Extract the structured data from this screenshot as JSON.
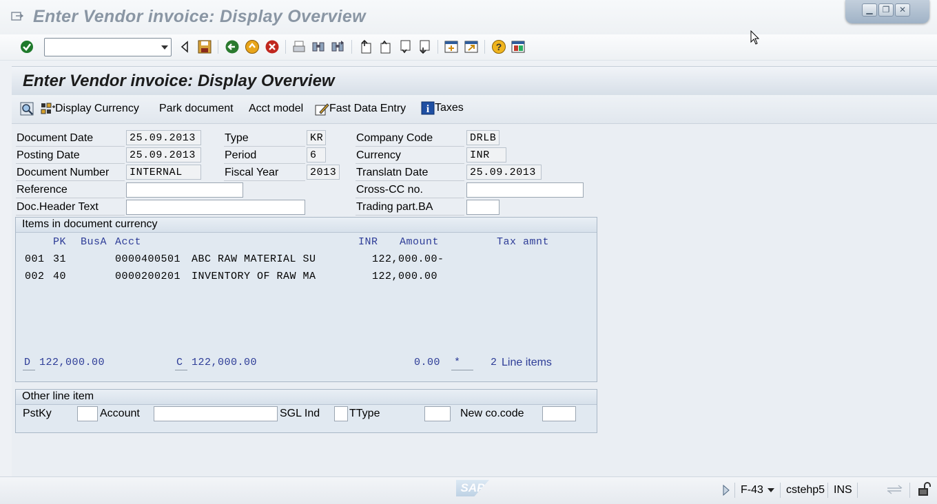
{
  "window": {
    "title": "Enter Vendor invoice: Display Overview"
  },
  "toolbar": {
    "command_value": "",
    "icons": [
      "enter-checkmark-icon",
      "back-arrow-icon",
      "save-icon",
      "back-green-icon",
      "exit-yellow-icon",
      "cancel-red-icon",
      "print-icon",
      "find-icon",
      "find-next-icon",
      "first-page-icon",
      "previous-page-icon",
      "next-page-icon",
      "last-page-icon",
      "new-session-icon",
      "shortcut-icon",
      "help-icon",
      "layout-menu-icon"
    ]
  },
  "screen": {
    "title": "Enter Vendor invoice: Display Overview"
  },
  "app_toolbar": {
    "display_currency": "Display Currency",
    "park_document": "Park document",
    "acct_model": "Acct model",
    "fast_data_entry": "Fast Data Entry",
    "taxes": "Taxes"
  },
  "header": {
    "document_date": {
      "label": "Document Date",
      "value": "25.09.2013"
    },
    "posting_date": {
      "label": "Posting Date",
      "value": "25.09.2013"
    },
    "document_number": {
      "label": "Document Number",
      "value": "INTERNAL"
    },
    "reference": {
      "label": "Reference",
      "value": ""
    },
    "doc_header_text": {
      "label": "Doc.Header Text",
      "value": ""
    },
    "type": {
      "label": "Type",
      "value": "KR"
    },
    "period": {
      "label": "Period",
      "value": "6"
    },
    "fiscal_year": {
      "label": "Fiscal Year",
      "value": "2013"
    },
    "company_code": {
      "label": "Company Code",
      "value": "DRLB"
    },
    "currency": {
      "label": "Currency",
      "value": "INR"
    },
    "translatn_date": {
      "label": "Translatn Date",
      "value": "25.09.2013"
    },
    "cross_cc_no": {
      "label": "Cross-CC no.",
      "value": ""
    },
    "trading_part_ba": {
      "label": "Trading part.BA",
      "value": ""
    }
  },
  "items": {
    "title": "Items in document currency",
    "columns": {
      "pk": "PK",
      "busa": "BusA",
      "acct": "Acct",
      "curr": "INR",
      "amount": "Amount",
      "tax": "Tax amnt"
    },
    "rows": [
      {
        "no": "001",
        "pk": "31",
        "acct": "0000400501",
        "desc": "ABC RAW MATERIAL SU",
        "amount": "122,000.00-"
      },
      {
        "no": "002",
        "pk": "40",
        "acct": "0000200201",
        "desc": "INVENTORY OF RAW MA",
        "amount": "122,000.00"
      }
    ],
    "totals": {
      "d_label": "D",
      "d_value": "122,000.00",
      "c_label": "C",
      "c_value": "122,000.00",
      "balance": "0.00",
      "indicator": "*",
      "line_count": "2",
      "line_label": "Line items"
    }
  },
  "other_line": {
    "title": "Other line item",
    "pstky_label": "PstKy",
    "account_label": "Account",
    "sgl_label": "SGL Ind",
    "ttype_label": "TType",
    "new_cocode_label": "New co.code"
  },
  "status": {
    "transaction": "F-43",
    "server": "cstehp5",
    "mode": "INS",
    "logo": "SAP"
  }
}
